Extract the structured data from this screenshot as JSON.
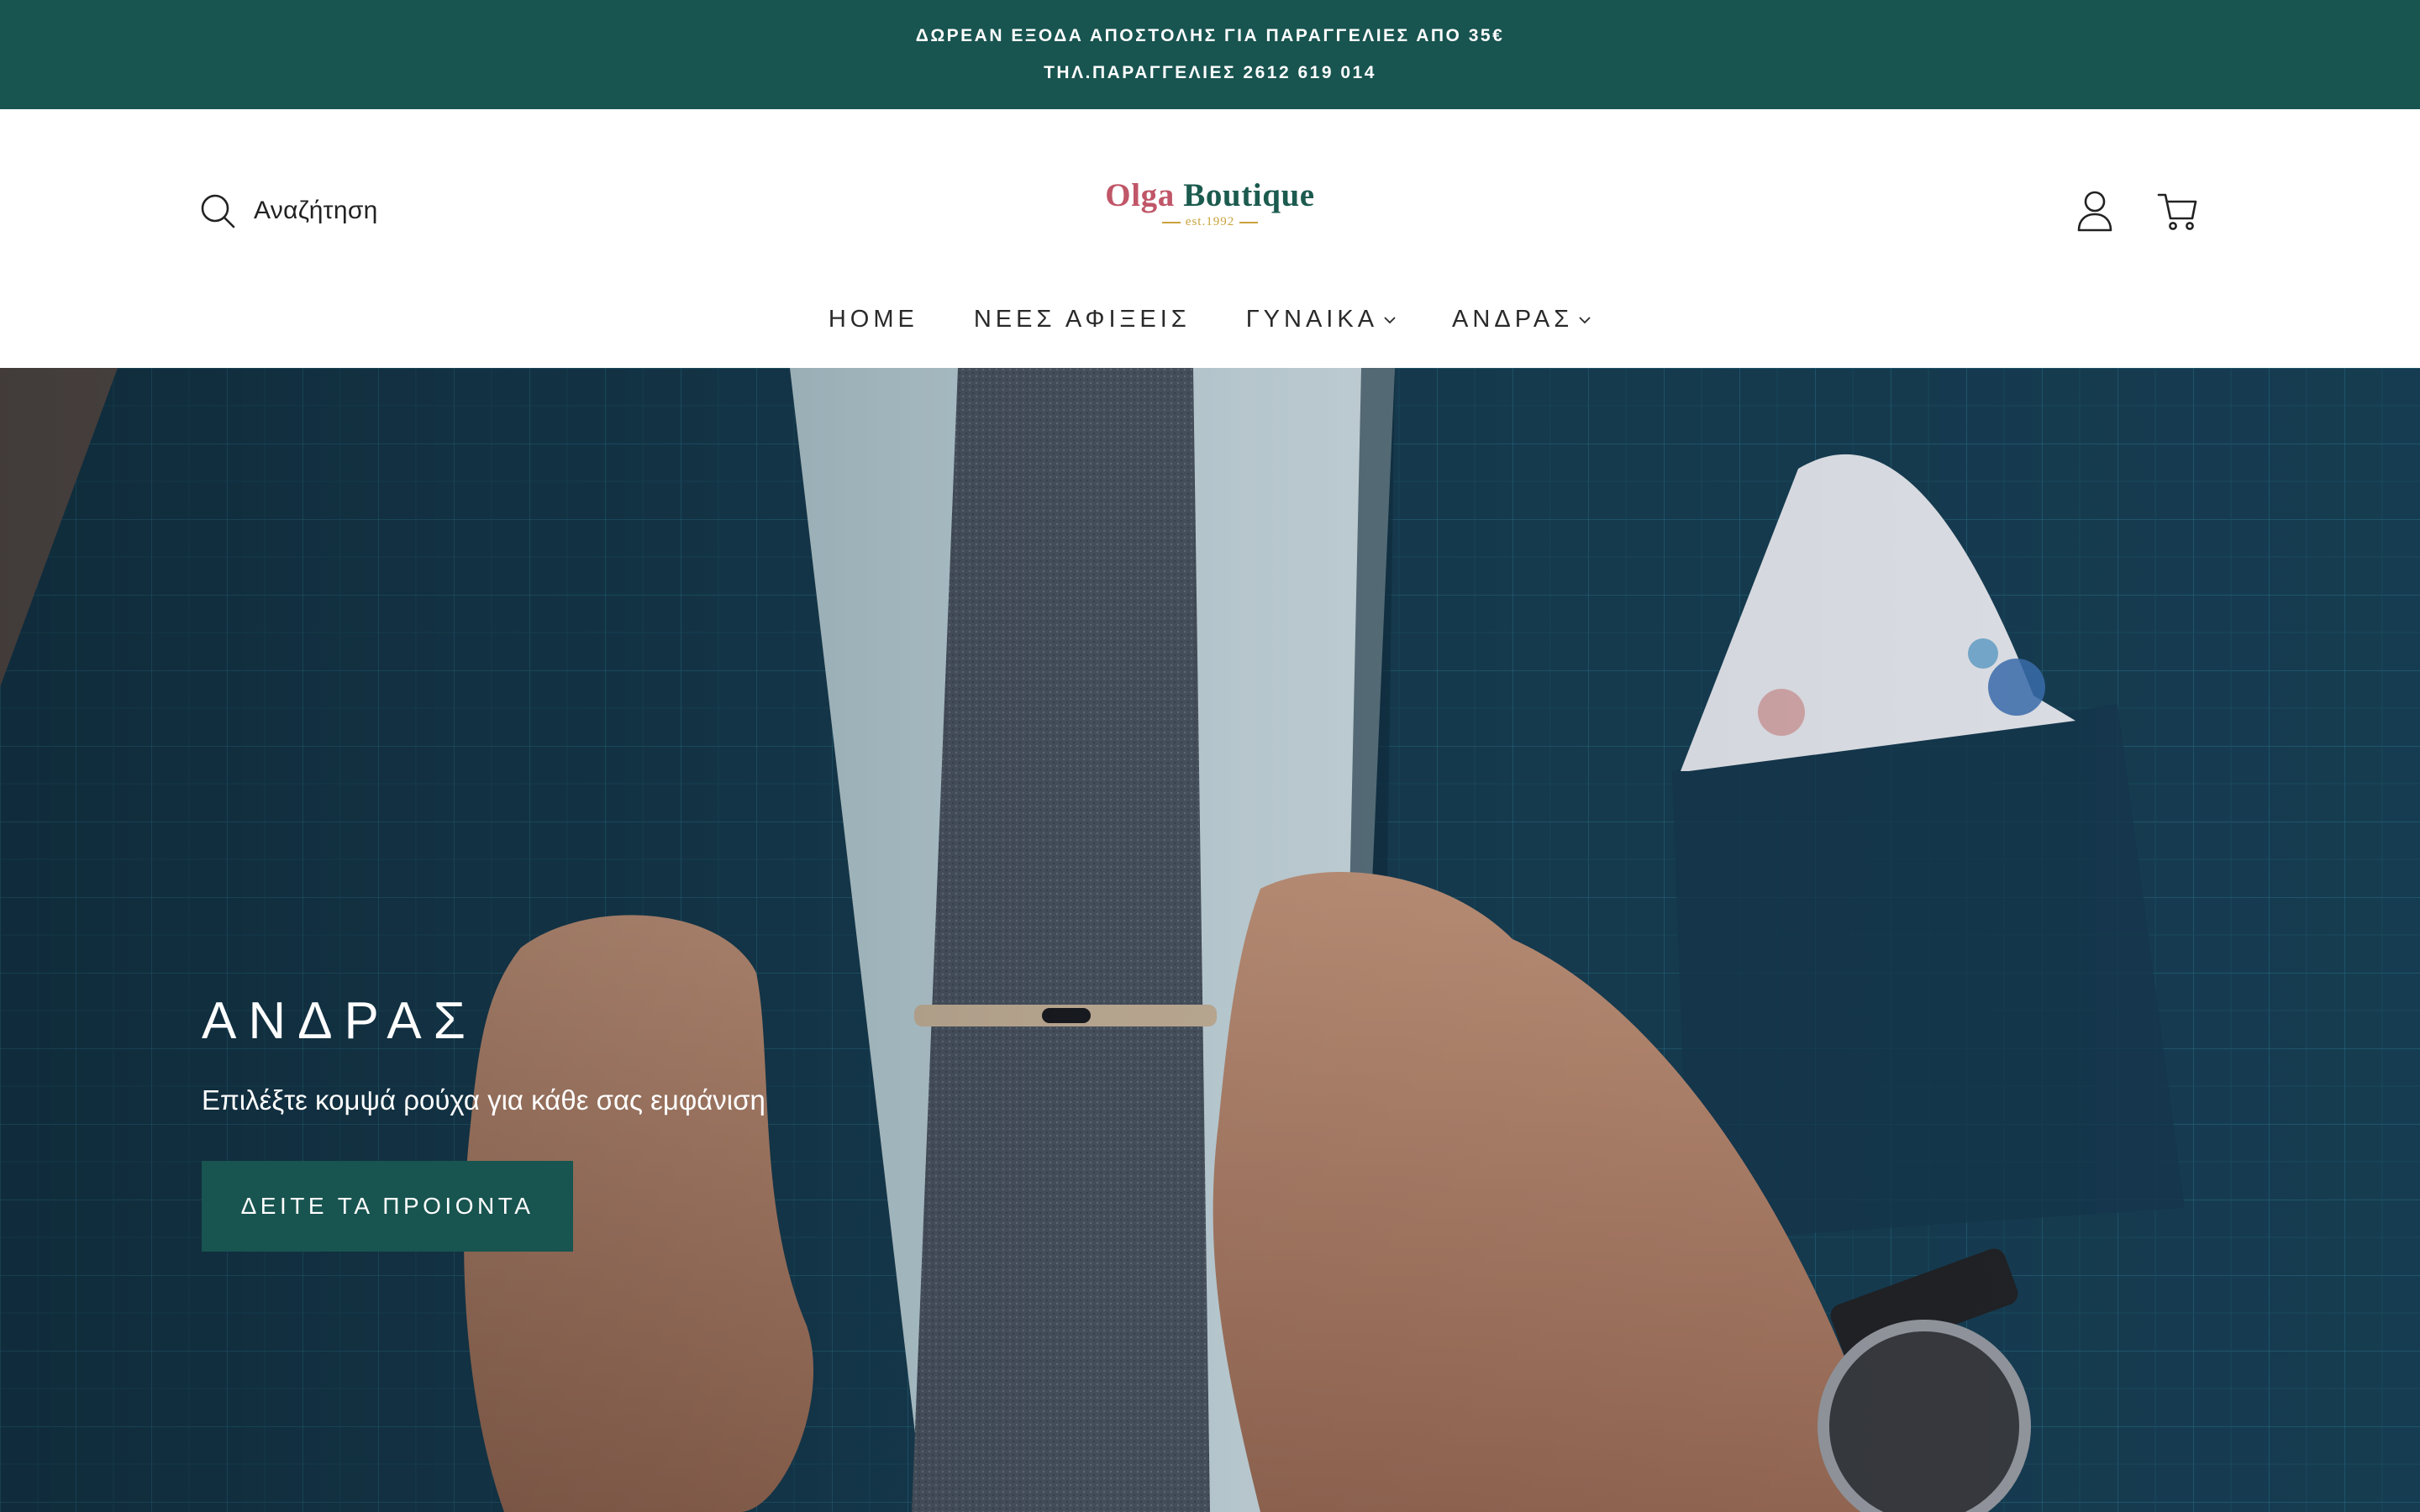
{
  "announcement": {
    "line1": "ΔΩΡΕΑΝ ΕΞΟΔΑ ΑΠΟΣΤΟΛΗΣ ΓΙΑ ΠΑΡΑΓΓΕΛΙΕΣ ΑΠΟ 35€",
    "line2": "ΤΗΛ.ΠΑΡΑΓΓΕΛΙΕΣ 2612 619 014"
  },
  "header": {
    "search_label": "Αναζήτηση",
    "logo": {
      "word1": "Olga",
      "word2": "Boutique",
      "tagline": "est.1992"
    },
    "icons": [
      "search-icon",
      "account-icon",
      "cart-icon"
    ]
  },
  "nav": {
    "items": [
      {
        "label": "HOME",
        "dropdown": false
      },
      {
        "label": "ΝΕΕΣ ΑΦΙΞΕΙΣ",
        "dropdown": false
      },
      {
        "label": "ΓΥΝΑΙΚΑ",
        "dropdown": true
      },
      {
        "label": "ΑΝΔΡΑΣ",
        "dropdown": true
      }
    ]
  },
  "hero": {
    "title": "ΑΝΔΡΑΣ",
    "subtitle": "Επιλέξτε κομψά ρούχα για κάθε σας εμφάνιση",
    "button_label": "ΔΕΙΤΕ ΤΑ ΠΡΟΙΟΝΤΑ"
  },
  "colors": {
    "brand_green": "#185450",
    "logo_pink": "#c05668",
    "logo_gold": "#c9a23d"
  }
}
